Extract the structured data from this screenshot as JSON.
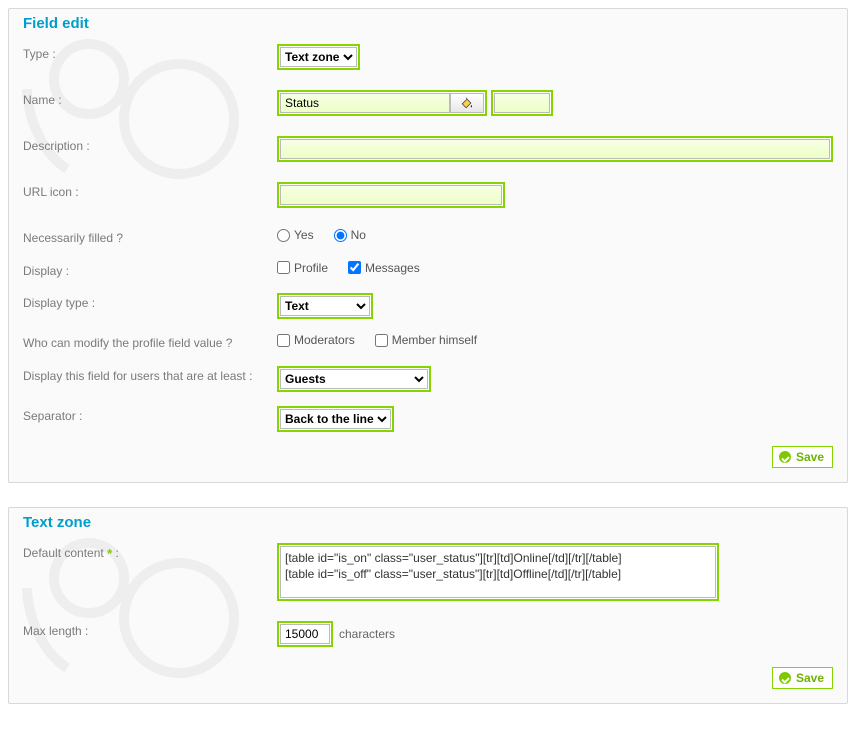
{
  "panel1": {
    "title": "Field edit",
    "labels": {
      "type": "Type :",
      "name": "Name :",
      "description": "Description :",
      "url_icon": "URL icon :",
      "necessarily": "Necessarily filled ?",
      "display": "Display :",
      "display_type": "Display type :",
      "who_modify": "Who can modify the profile field value ?",
      "display_for": "Display this field for users that are at least :",
      "separator": "Separator :"
    },
    "type_value": "Text zone",
    "name_value": "Status",
    "name_extra": "",
    "description_value": "",
    "url_icon_value": "",
    "yes": "Yes",
    "no": "No",
    "profile": "Profile",
    "messages": "Messages",
    "display_type_value": "Text",
    "moderators": "Moderators",
    "member_himself": "Member himself",
    "display_for_value": "Guests",
    "separator_value": "Back to the line",
    "save": "Save"
  },
  "panel2": {
    "title": "Text zone",
    "labels": {
      "default_content": "Default content",
      "max_length": "Max length :"
    },
    "default_content_value": "[table id=\"is_on\" class=\"user_status\"][tr][td]Online[/td][/tr][/table]\n[table id=\"is_off\" class=\"user_status\"][tr][td]Offline[/td][/tr][/table]",
    "max_length_value": "15000",
    "characters": "characters",
    "save": "Save"
  }
}
